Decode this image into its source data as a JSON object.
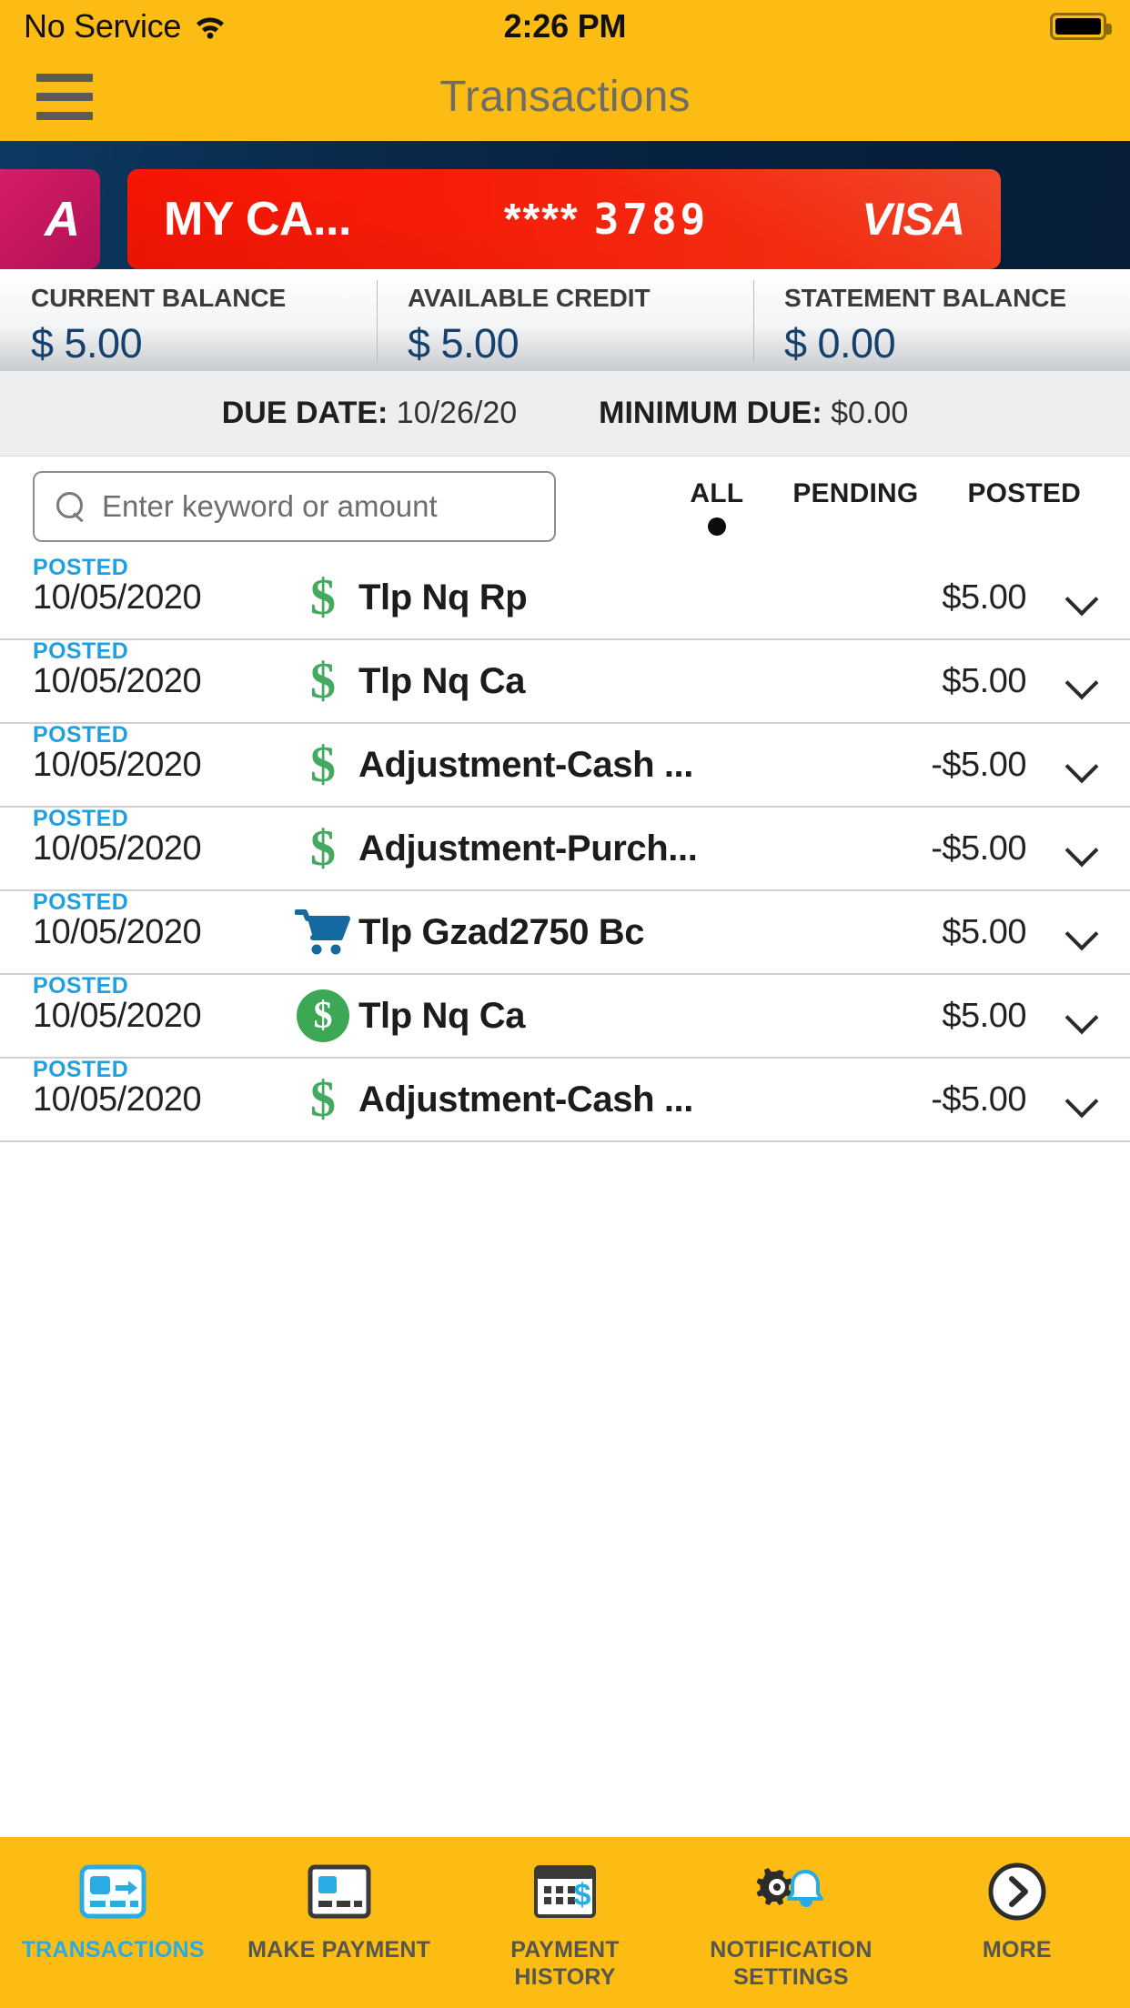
{
  "statusbar": {
    "carrier": "No Service",
    "time": "2:26 PM",
    "wifi_icon": "wifi-icon",
    "battery_icon": "battery-full-icon"
  },
  "header": {
    "title": "Transactions",
    "menu_icon": "hamburger-menu-icon"
  },
  "card_carousel": {
    "prev_card": {
      "partial_text": "A",
      "color": "#d01a63"
    },
    "active_card": {
      "name": "MY CA...",
      "mask": "****",
      "last_four": "3789",
      "network": "VISA",
      "color": "#f71c08"
    },
    "background_color": "#0a2b4d"
  },
  "balances": [
    {
      "label": "CURRENT BALANCE",
      "value": "$ 5.00"
    },
    {
      "label": "AVAILABLE CREDIT",
      "value": "$ 5.00"
    },
    {
      "label": "STATEMENT BALANCE",
      "value": "$ 0.00"
    }
  ],
  "due_row": {
    "due_date_label": "DUE DATE:",
    "due_date_value": "10/26/20",
    "minimum_due_label": "MINIMUM DUE:",
    "minimum_due_value": "$0.00"
  },
  "search": {
    "placeholder": "Enter keyword or amount",
    "value": "",
    "icon": "search-icon"
  },
  "filters": {
    "selected": "ALL",
    "tabs": [
      {
        "label": "ALL",
        "selected": true
      },
      {
        "label": "PENDING",
        "selected": false
      },
      {
        "label": "POSTED",
        "selected": false
      }
    ]
  },
  "transactions": [
    {
      "status": "POSTED",
      "date": "10/05/2020",
      "icon": "dollar-sign-icon",
      "description": "Tlp Nq Rp",
      "amount": "$5.00"
    },
    {
      "status": "POSTED",
      "date": "10/05/2020",
      "icon": "dollar-sign-icon",
      "description": "Tlp Nq Ca",
      "amount": "$5.00"
    },
    {
      "status": "POSTED",
      "date": "10/05/2020",
      "icon": "dollar-sign-icon",
      "description": "Adjustment-Cash ...",
      "amount": "-$5.00"
    },
    {
      "status": "POSTED",
      "date": "10/05/2020",
      "icon": "dollar-sign-icon",
      "description": "Adjustment-Purch...",
      "amount": "-$5.00"
    },
    {
      "status": "POSTED",
      "date": "10/05/2020",
      "icon": "shopping-cart-icon",
      "description": "Tlp Gzad2750 Bc",
      "amount": "$5.00"
    },
    {
      "status": "POSTED",
      "date": "10/05/2020",
      "icon": "dollar-circle-icon",
      "description": "Tlp Nq Ca",
      "amount": "$5.00"
    },
    {
      "status": "POSTED",
      "date": "10/05/2020",
      "icon": "dollar-sign-icon",
      "description": "Adjustment-Cash ...",
      "amount": "-$5.00"
    }
  ],
  "tabbar": {
    "items": [
      {
        "label": "TRANSACTIONS",
        "icon": "card-transfer-icon",
        "active": true
      },
      {
        "label": "MAKE PAYMENT",
        "icon": "credit-card-icon",
        "active": false
      },
      {
        "label": "PAYMENT\nHISTORY",
        "icon": "calendar-dollar-icon",
        "active": false
      },
      {
        "label": "NOTIFICATION\nSETTINGS",
        "icon": "gear-bell-icon",
        "active": false
      },
      {
        "label": "MORE",
        "icon": "chevron-right-circle-icon",
        "active": false
      }
    ]
  },
  "colors": {
    "brand_yellow": "#FDBC14",
    "accent_blue": "#21a0e0",
    "balance_navy": "#14416e",
    "positive_green": "#43aa5f",
    "card_red": "#f71c08"
  }
}
